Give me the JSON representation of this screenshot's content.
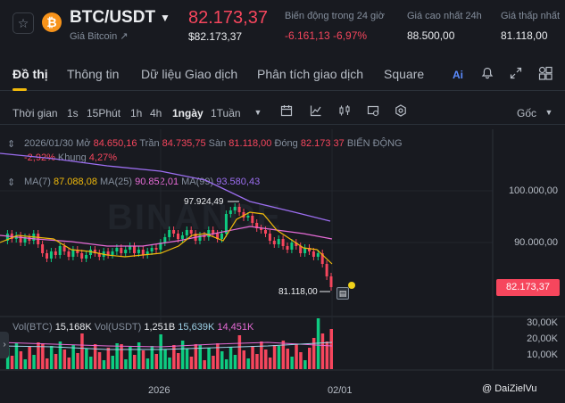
{
  "header": {
    "star_icon": "star-icon",
    "coin_icon": "bitcoin-icon",
    "pair": "BTC/USDT",
    "subtitle": "Giá Bitcoin ↗",
    "price": "82.173,37",
    "price_usd": "$82.173,37",
    "stats": [
      {
        "label": "Biến động trong 24 giờ",
        "value": "-6.161,13 -6,97%",
        "color": "#f6465d"
      },
      {
        "label": "Giá cao nhất 24h",
        "value": "88.500,00",
        "color": "#eaecef"
      },
      {
        "label": "Giá thấp nhất",
        "value": "81.118,00",
        "color": "#eaecef"
      }
    ]
  },
  "tabs": [
    "Đồ thị",
    "Thông tin",
    "Dữ liệu Giao dịch",
    "Phân tích giao dịch",
    "Square"
  ],
  "tab_icons": [
    "ai-icon",
    "bell-icon",
    "expand-icon",
    "grid-icon"
  ],
  "toolbar": {
    "label": "Thời gian",
    "intervals": [
      "1s",
      "15Phút",
      "1h",
      "4h",
      "1ngày",
      "1Tuần"
    ],
    "active_interval": "1ngày",
    "dropdown": "Gốc"
  },
  "ohlc": {
    "date": "2026/01/30",
    "open_label": "Mở",
    "open": "84.650,16",
    "high_label": "Trần",
    "high": "84.735,75",
    "low_label": "Sàn",
    "low": "81.118,00",
    "close_label": "Đóng",
    "close": "82.173,37",
    "change_label": "BIẾN ĐỘNG",
    "change": "-2,92%",
    "range_label": "Khung",
    "range": "4,27%"
  },
  "ma": {
    "ma7_label": "MA(7)",
    "ma7": "87.088,08",
    "ma25_label": "MA(25)",
    "ma25": "90.852,01",
    "ma99_label": "MA(99)",
    "ma99": "93.580,43"
  },
  "price_axis": [
    "100.000,00",
    "90.000,00"
  ],
  "current_price_tag": "82.173,37",
  "annotations": {
    "high": "97.924,49",
    "low": "81.118,00"
  },
  "volume": {
    "btc_label": "Vol(BTC)",
    "btc": "15,168K",
    "usdt_label": "Vol(USDT)",
    "usdt": "1,251B",
    "v1": "15,639K",
    "v2": "14,451K",
    "axis": [
      "30,00K",
      "20,00K",
      "10,00K"
    ]
  },
  "dates": [
    "2026",
    "02/01"
  ],
  "credit": "@ DaiZielVu",
  "watermark": "BINANCE",
  "colors": {
    "up": "#0ecb81",
    "down": "#f6465d",
    "accent": "#f0b90b",
    "ma7": "#f0b90b",
    "ma25": "#e66bd6",
    "ma99": "#9c6ef0"
  }
}
